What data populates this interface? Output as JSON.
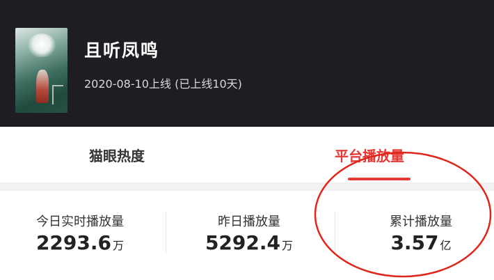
{
  "header": {
    "title": "且听凤鸣",
    "release_info": "2020-08-10上线 (已上线10天)"
  },
  "tabs": [
    {
      "label": "猫眼热度",
      "active": false
    },
    {
      "label": "平台播放量",
      "active": true
    }
  ],
  "stats": [
    {
      "label": "今日实时播放量",
      "value": "2293.6",
      "unit": "万"
    },
    {
      "label": "昨日播放量",
      "value": "5292.4",
      "unit": "万"
    },
    {
      "label": "累计播放量",
      "value": "3.57",
      "unit": "亿"
    }
  ],
  "colors": {
    "header_bg": "#1d1d23",
    "accent": "#e53935",
    "annotation": "#e0261b"
  }
}
